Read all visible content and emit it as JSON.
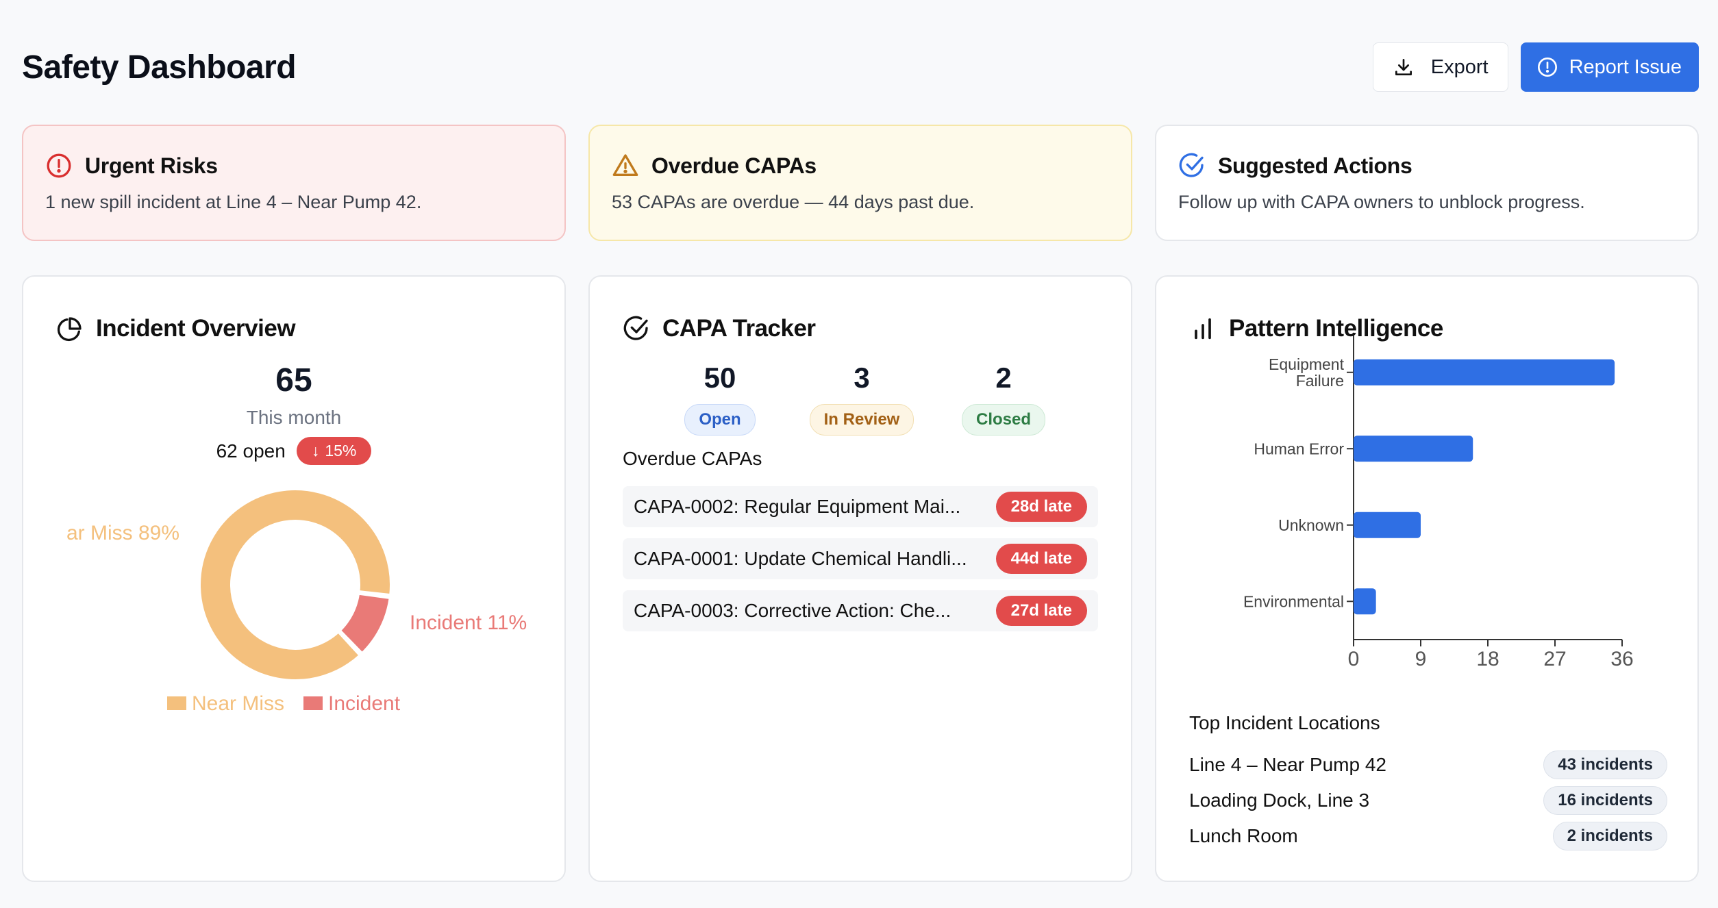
{
  "header": {
    "title": "Safety Dashboard",
    "export_label": "Export",
    "report_label": "Report Issue"
  },
  "alerts": {
    "urgent": {
      "title": "Urgent Risks",
      "text": "1 new spill incident at Line 4 – Near Pump 42."
    },
    "overdue": {
      "title": "Overdue CAPAs",
      "text": "53 CAPAs are overdue — 44 days past due."
    },
    "suggested": {
      "title": "Suggested Actions",
      "text": "Follow up with CAPA owners to unblock progress."
    }
  },
  "incident_overview": {
    "title": "Incident Overview",
    "total": "65",
    "period": "This month",
    "open": "62 open",
    "trend": "15%",
    "trend_arrow": "↓",
    "slice_labels": {
      "near_miss": "ar Miss 89%",
      "incident": "Incident 11%"
    },
    "legend": {
      "near_miss": "Near Miss",
      "incident": "Incident"
    }
  },
  "capa_tracker": {
    "title": "CAPA Tracker",
    "stats": [
      {
        "value": "50",
        "label": "Open"
      },
      {
        "value": "3",
        "label": "In Review"
      },
      {
        "value": "2",
        "label": "Closed"
      }
    ],
    "overdue_label": "Overdue CAPAs",
    "overdue": [
      {
        "name": "CAPA-0002: Regular Equipment Mai...",
        "late": "28d late"
      },
      {
        "name": "CAPA-0001: Update Chemical Handli...",
        "late": "44d late"
      },
      {
        "name": "CAPA-0003: Corrective Action: Che...",
        "late": "27d late"
      }
    ]
  },
  "pattern": {
    "title": "Pattern Intelligence",
    "locations_title": "Top Incident Locations",
    "locations": [
      {
        "name": "Line 4 – Near Pump 42",
        "count": "43 incidents"
      },
      {
        "name": "Loading Dock, Line 3",
        "count": "16 incidents"
      },
      {
        "name": "Lunch Room",
        "count": "2 incidents"
      }
    ]
  },
  "chart_data": [
    {
      "type": "pie",
      "categories": [
        "Near Miss",
        "Incident"
      ],
      "values": [
        89,
        11
      ],
      "colors": [
        "#f4c07d",
        "#e97a77"
      ],
      "legend": "bottom"
    },
    {
      "type": "bar",
      "orientation": "horizontal",
      "categories": [
        "Equipment Failure",
        "Human Error",
        "Unknown",
        "Environmental"
      ],
      "values": [
        35,
        16,
        9,
        3
      ],
      "xlim": [
        0,
        36
      ],
      "xticks": [
        "0",
        "9",
        "18",
        "27",
        "36"
      ],
      "color": "#2f6fe4"
    }
  ],
  "colors": {
    "accent": "#2f6fe4",
    "danger": "#e24b4b",
    "warning": "#c07a1d",
    "near_miss": "#f4c07d",
    "incident": "#e97a77"
  }
}
